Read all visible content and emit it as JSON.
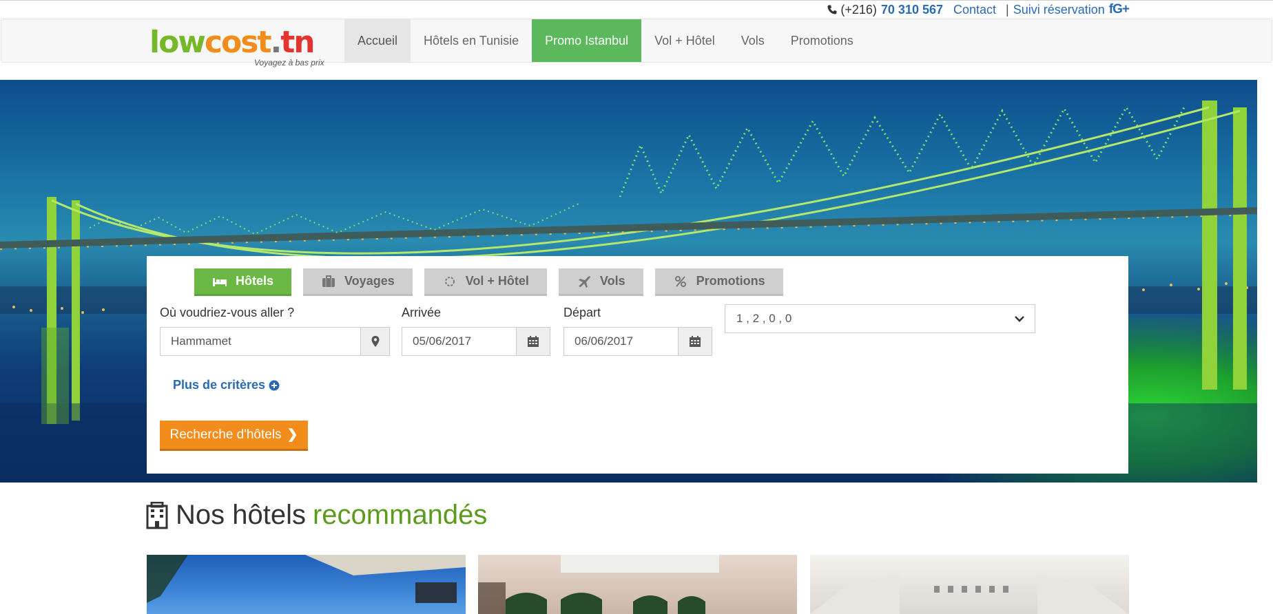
{
  "topbar": {
    "phone_prefix": "(+216)",
    "phone_number": "70 310 567",
    "contact": "Contact",
    "separator": "|",
    "tracking": "Suivi réservation",
    "social": "fG+"
  },
  "logo": {
    "part1": "low",
    "part2": "cost",
    "part3": ".",
    "part4": "tn",
    "tagline": "Voyagez à bas prix"
  },
  "nav": {
    "items": [
      {
        "label": "Accueil"
      },
      {
        "label": "Hôtels en Tunisie"
      },
      {
        "label": "Promo Istanbul"
      },
      {
        "label": "Vol + Hôtel"
      },
      {
        "label": "Vols"
      },
      {
        "label": "Promotions"
      }
    ]
  },
  "search": {
    "tabs": [
      {
        "label": "Hôtels",
        "icon": "bed-icon"
      },
      {
        "label": "Voyages",
        "icon": "suitcase-icon"
      },
      {
        "label": "Vol + Hôtel",
        "icon": "sun-icon"
      },
      {
        "label": "Vols",
        "icon": "plane-icon"
      },
      {
        "label": "Promotions",
        "icon": "percent-icon"
      }
    ],
    "destination_label": "Où voudriez-vous aller ?",
    "destination_value": "Hammamet",
    "arrival_label": "Arrivée",
    "arrival_value": "05/06/2017",
    "departure_label": "Départ",
    "departure_value": "06/06/2017",
    "rooms_value": "1 , 2 , 0 , 0",
    "more_criteria": "Plus de critères",
    "search_button": "Recherche d'hôtels"
  },
  "recommended": {
    "title_main": "Nos hôtels",
    "title_accent": "recommandés"
  },
  "colors": {
    "accent_green": "#6cb847",
    "accent_orange": "#f28c1b",
    "link_blue": "#2a6ab4"
  }
}
